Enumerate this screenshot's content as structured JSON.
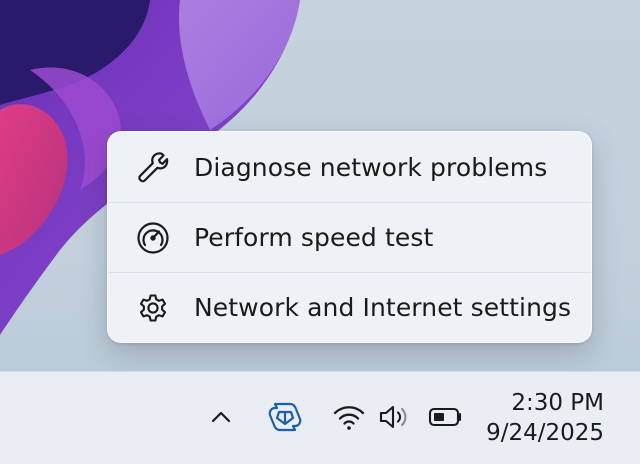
{
  "menu": {
    "items": [
      {
        "label": "Diagnose network problems",
        "icon": "wrench-icon"
      },
      {
        "label": "Perform speed test",
        "icon": "speedometer-icon"
      },
      {
        "label": "Network and Internet settings",
        "icon": "gear-icon"
      }
    ]
  },
  "taskbar": {
    "tray_icons": [
      "chevron-up-icon",
      "copilot-icon",
      "wifi-icon",
      "volume-icon",
      "battery-icon"
    ],
    "accent_color": "#1c5fae"
  },
  "clock": {
    "time": "2:30 PM",
    "date": "9/24/2025"
  }
}
